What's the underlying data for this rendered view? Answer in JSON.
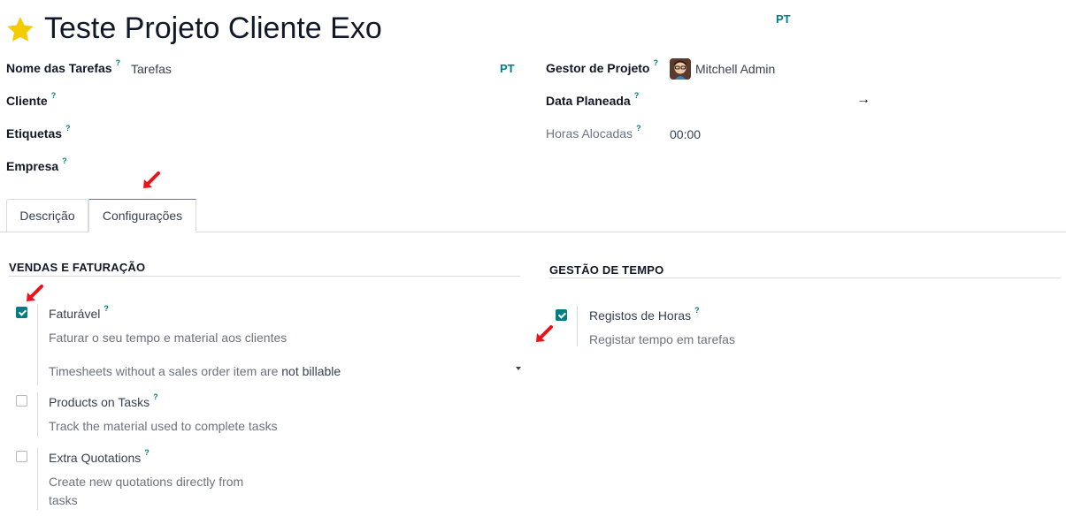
{
  "title": "Teste Projeto Cliente Exo",
  "title_lang": "PT",
  "fields": {
    "task_name_label": "Nome das Tarefas",
    "task_name_value": "Tarefas",
    "task_name_lang": "PT",
    "customer_label": "Cliente",
    "tags_label": "Etiquetas",
    "company_label": "Empresa",
    "manager_label": "Gestor de Projeto",
    "manager_value": "Mitchell Admin",
    "planned_date_label": "Data Planeada",
    "planned_date_arrow": "→",
    "allocated_hours_label": "Horas Alocadas",
    "allocated_hours_value": "00:00",
    "help_mark": "?"
  },
  "tabs": [
    {
      "label": "Descrição",
      "active": false
    },
    {
      "label": "Configurações",
      "active": true
    }
  ],
  "sales": {
    "header": "VENDAS E FATURAÇÃO",
    "billable": {
      "label": "Faturável",
      "checked": true,
      "desc": "Faturar o seu tempo e material aos clientes",
      "select_prefix": "Timesheets without a sales order item are",
      "select_value": "not billable"
    },
    "products": {
      "label": "Products on Tasks",
      "checked": false,
      "desc": "Track the material used to complete tasks"
    },
    "quotations": {
      "label": "Extra Quotations",
      "checked": false,
      "desc_line1": "Create new quotations directly from",
      "desc_line2": "tasks"
    }
  },
  "time": {
    "header": "GESTÃO DE TEMPO",
    "timesheets": {
      "label": "Registos de Horas",
      "checked": true,
      "desc": "Registar tempo em tarefas"
    }
  },
  "colors": {
    "accent": "#017e84",
    "star": "#f3cc00",
    "annotation_arrow": "#e8141b"
  }
}
